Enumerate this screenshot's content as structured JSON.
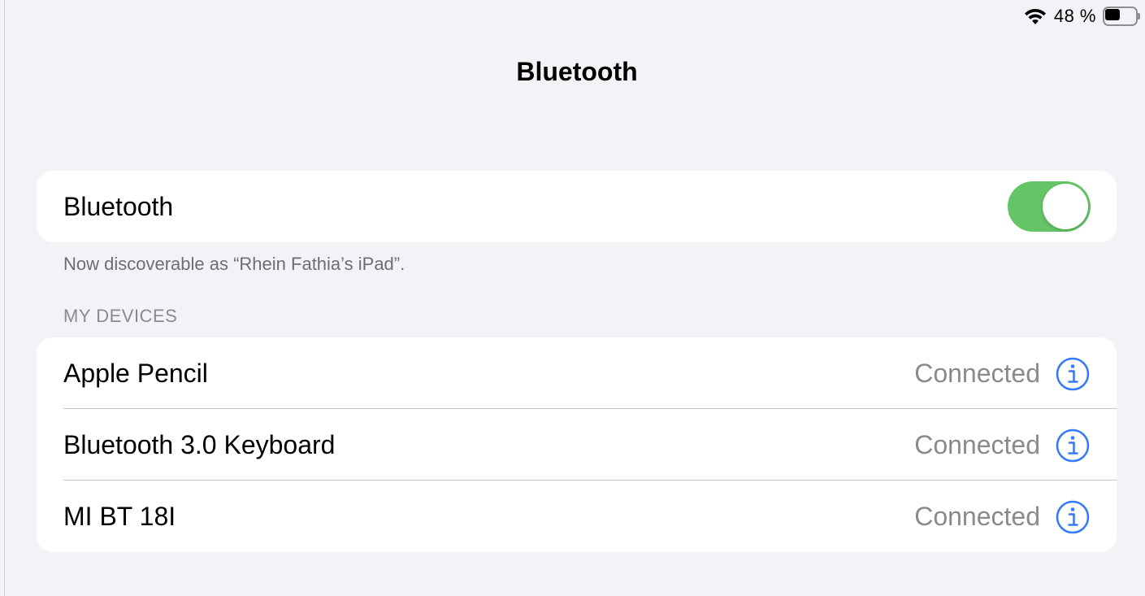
{
  "status_bar": {
    "wifi_icon": "wifi-icon",
    "battery_percent_text": "48 %",
    "battery_level": 0.48,
    "battery_icon": "battery-icon"
  },
  "nav": {
    "title": "Bluetooth"
  },
  "bluetooth_toggle": {
    "label": "Bluetooth",
    "on": true,
    "on_color": "#65c466"
  },
  "discoverable_note": "Now discoverable as “Rhein Fathia’s iPad”.",
  "my_devices": {
    "header": "MY DEVICES",
    "devices": [
      {
        "name": "Apple Pencil",
        "status": "Connected",
        "icon": "info-icon"
      },
      {
        "name": "Bluetooth 3.0 Keyboard",
        "status": "Connected",
        "icon": "info-icon"
      },
      {
        "name": "MI BT 18I",
        "status": "Connected",
        "icon": "info-icon"
      }
    ]
  },
  "colors": {
    "background": "#f2f2f7",
    "accent_blue": "#3478f6",
    "secondary_text": "#8a8a8e"
  }
}
